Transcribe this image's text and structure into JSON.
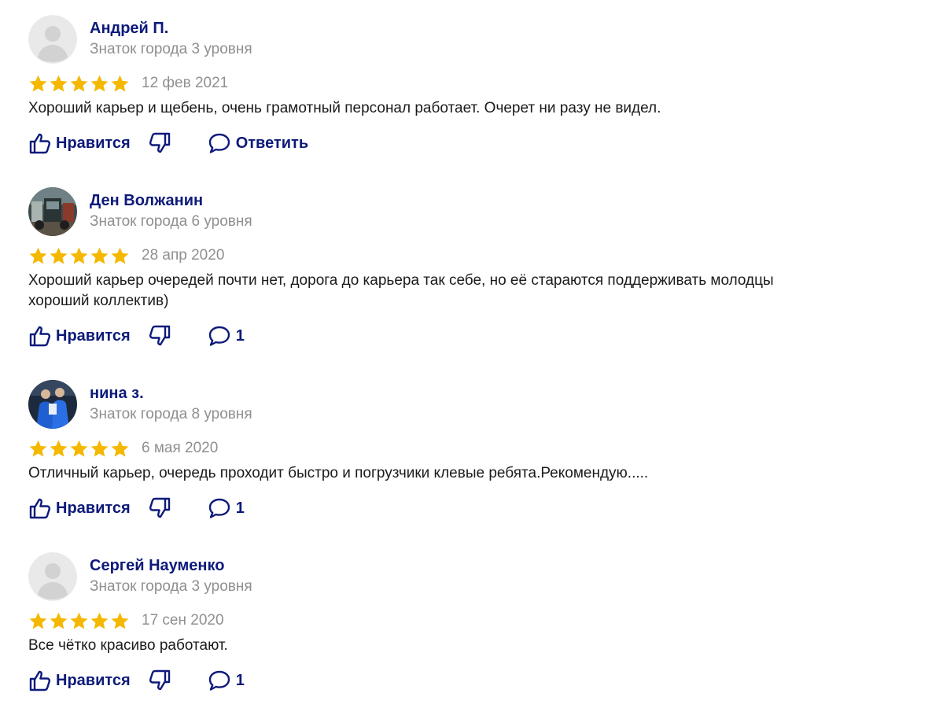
{
  "reviews": [
    {
      "author": "Андрей П.",
      "level": "Знаток города 3 уровня",
      "avatar": "default-avatar-icon",
      "rating": 5,
      "date": "12 фев 2021",
      "text": "Хороший карьер и щебень, очень грамотный персонал работает. Очерет ни разу не видел.",
      "like_label": "Нравится",
      "reply_label": "Ответить"
    },
    {
      "author": "Ден Волжанин",
      "level": "Знаток города 6 уровня",
      "avatar": "photo-avatar-truck",
      "rating": 5,
      "date": "28 апр 2020",
      "text": "Хороший карьер очередей почти нет, дорога до карьера так себе, но её стараются поддерживать молодцы хороший коллектив)",
      "like_label": "Нравится",
      "reply_label": "1"
    },
    {
      "author": "нина з.",
      "level": "Знаток города 8 уровня",
      "avatar": "photo-avatar-people",
      "rating": 5,
      "date": "6 мая 2020",
      "text": "Отличный карьер, очередь проходит быстро и погрузчики клевые ребята.Рекомендую.....",
      "like_label": "Нравится",
      "reply_label": "1"
    },
    {
      "author": "Сергей Науменко",
      "level": "Знаток города 3 уровня",
      "avatar": "default-avatar-icon",
      "rating": 5,
      "date": "17 сен 2020",
      "text": "Все чётко красиво работают.",
      "like_label": "Нравится",
      "reply_label": "1"
    }
  ],
  "icons": {
    "star": "star-icon",
    "like": "thumbs-up-icon",
    "dislike": "thumbs-down-icon",
    "comment": "comment-bubble-icon"
  },
  "colors": {
    "link": "#0d1a7a",
    "muted": "#8f8f8f",
    "star": "#f5b800",
    "text": "#1b1b1b"
  }
}
